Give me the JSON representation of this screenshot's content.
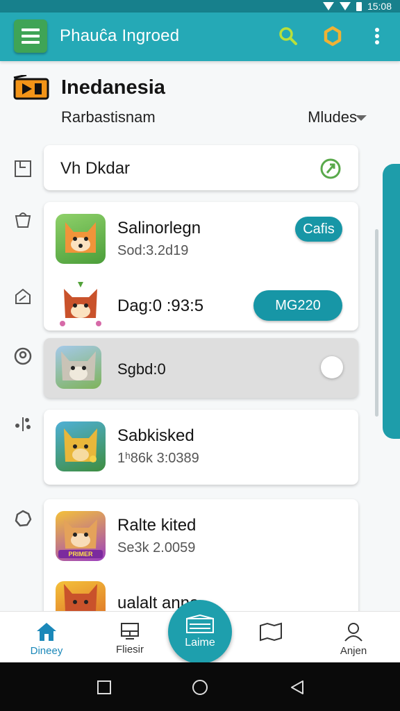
{
  "status_bar": {
    "time": "15:08"
  },
  "app_bar": {
    "title": "Phauĉa Ingroed"
  },
  "header": {
    "title": "Inedanesia",
    "subtitle": "Rarbastisnam",
    "filter_label": "Mludes"
  },
  "search": {
    "value": "Vh Dkdar"
  },
  "games": [
    {
      "title": "Salinorlegn",
      "meta": "Sod:3.2d19",
      "action": "Cafis"
    },
    {
      "title": "Dag:0 :93:5",
      "meta": "",
      "action": "MG220"
    },
    {
      "title": "Sgbd:0",
      "meta": ""
    },
    {
      "title": "Sabkisked",
      "meta": "1ʰ86k 3:0389"
    },
    {
      "title": "Ralte kited",
      "meta": "Se3k 2.0059",
      "icon_text": "PRIMER"
    },
    {
      "title": "ualalt anna",
      "meta": ""
    }
  ],
  "bottom_nav": {
    "items": [
      {
        "label": "Dineey"
      },
      {
        "label": "Fliesir"
      },
      {
        "label": "Laime"
      },
      {
        "label": ""
      },
      {
        "label": "Anjen"
      }
    ]
  },
  "colors": {
    "status_bar": "#17808c",
    "app_bar": "#25a9b6",
    "accent": "#1796a6",
    "menu_button": "#3fa456"
  }
}
